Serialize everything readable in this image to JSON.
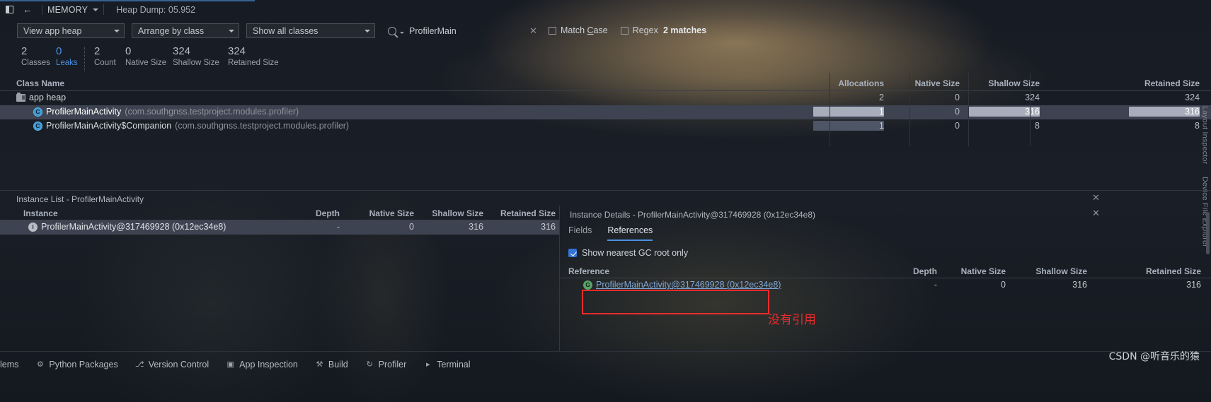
{
  "topbar": {
    "panel_icon": "panel-toggle-icon",
    "back_icon": "back-arrow-icon",
    "section": "MEMORY",
    "heap_dump": "Heap Dump: 05.952"
  },
  "filterbar": {
    "view_heap": "View app heap",
    "arrange_by": "Arrange by class",
    "show_classes": "Show all classes",
    "search_value": "ProfilerMain",
    "clear_icon": "clear-icon",
    "match_case": "Match Case",
    "match_case_checked": false,
    "regex": "Regex",
    "regex_checked": false,
    "matches": "2 matches"
  },
  "stats": [
    {
      "value": "2",
      "label": "Classes",
      "accent": false
    },
    {
      "value": "0",
      "label": "Leaks",
      "accent": true
    },
    {
      "value": "2",
      "label": "Count",
      "accent": false
    },
    {
      "value": "0",
      "label": "Native Size",
      "accent": false
    },
    {
      "value": "324",
      "label": "Shallow Size",
      "accent": false
    },
    {
      "value": "324",
      "label": "Retained Size",
      "accent": false
    }
  ],
  "class_table": {
    "headers": {
      "class_name": "Class Name",
      "allocations": "Allocations",
      "native_size": "Native Size",
      "shallow_size": "Shallow Size",
      "retained_size": "Retained Size"
    },
    "rows": [
      {
        "icon": "folder-icon",
        "name": "app heap",
        "package": "",
        "allocations": "2",
        "native_size": "0",
        "shallow_size": "324",
        "retained_size": "324"
      },
      {
        "icon": "class-icon",
        "name": "ProfilerMainActivity",
        "package": "(com.southgnss.testproject.modules.profiler)",
        "allocations": "1",
        "native_size": "0",
        "shallow_size": "316",
        "retained_size": "316"
      },
      {
        "icon": "class-icon",
        "name": "ProfilerMainActivity$Companion",
        "package": "(com.southgnss.testproject.modules.profiler)",
        "allocations": "1",
        "native_size": "0",
        "shallow_size": "8",
        "retained_size": "8"
      }
    ]
  },
  "instance_list": {
    "title": "Instance List - ProfilerMainActivity",
    "headers": {
      "instance": "Instance",
      "depth": "Depth",
      "native_size": "Native Size",
      "shallow_size": "Shallow Size",
      "retained_size": "Retained Size"
    },
    "rows": [
      {
        "icon": "instance-icon",
        "instance": "ProfilerMainActivity@317469928 (0x12ec34e8)",
        "depth": "-",
        "native_size": "0",
        "shallow_size": "316",
        "retained_size": "316"
      }
    ]
  },
  "instance_details": {
    "title": "Instance Details - ProfilerMainActivity@317469928 (0x12ec34e8)",
    "tabs": [
      {
        "label": "Fields",
        "active": false
      },
      {
        "label": "References",
        "active": true
      }
    ],
    "gc_root_option": "Show nearest GC root only",
    "gc_root_checked": true,
    "headers": {
      "reference": "Reference",
      "depth": "Depth",
      "native_size": "Native Size",
      "shallow_size": "Shallow Size",
      "retained_size": "Retained Size"
    },
    "rows": [
      {
        "icon": "gcroot-icon",
        "reference": "ProfilerMainActivity@317469928 (0x12ec34e8)",
        "depth": "-",
        "native_size": "0",
        "shallow_size": "316",
        "retained_size": "316"
      }
    ]
  },
  "annotation": {
    "text": "没有引用",
    "color": "#ec2b2b"
  },
  "bottombar": [
    {
      "icon": "python-packages-icon",
      "glyph": "⚙",
      "label": "Python Packages"
    },
    {
      "icon": "version-control-icon",
      "glyph": "⎇",
      "label": "Version Control"
    },
    {
      "icon": "app-inspection-icon",
      "glyph": "▣",
      "label": "App Inspection"
    },
    {
      "icon": "build-icon",
      "glyph": "⚒",
      "label": "Build"
    },
    {
      "icon": "profiler-icon",
      "glyph": "↻",
      "label": "Profiler"
    },
    {
      "icon": "terminal-icon",
      "glyph": "▸",
      "label": "Terminal"
    }
  ],
  "bottom_left_partial": "lems",
  "right_strip": [
    "Layout Inspector",
    "Device File Explorer"
  ],
  "watermark": "CSDN @听音乐的猿",
  "colors": {
    "accent_blue": "#4a90e2",
    "selection": "#3d4350",
    "highlight": "#a7adba",
    "annotation_red": "#ec2b2b"
  }
}
